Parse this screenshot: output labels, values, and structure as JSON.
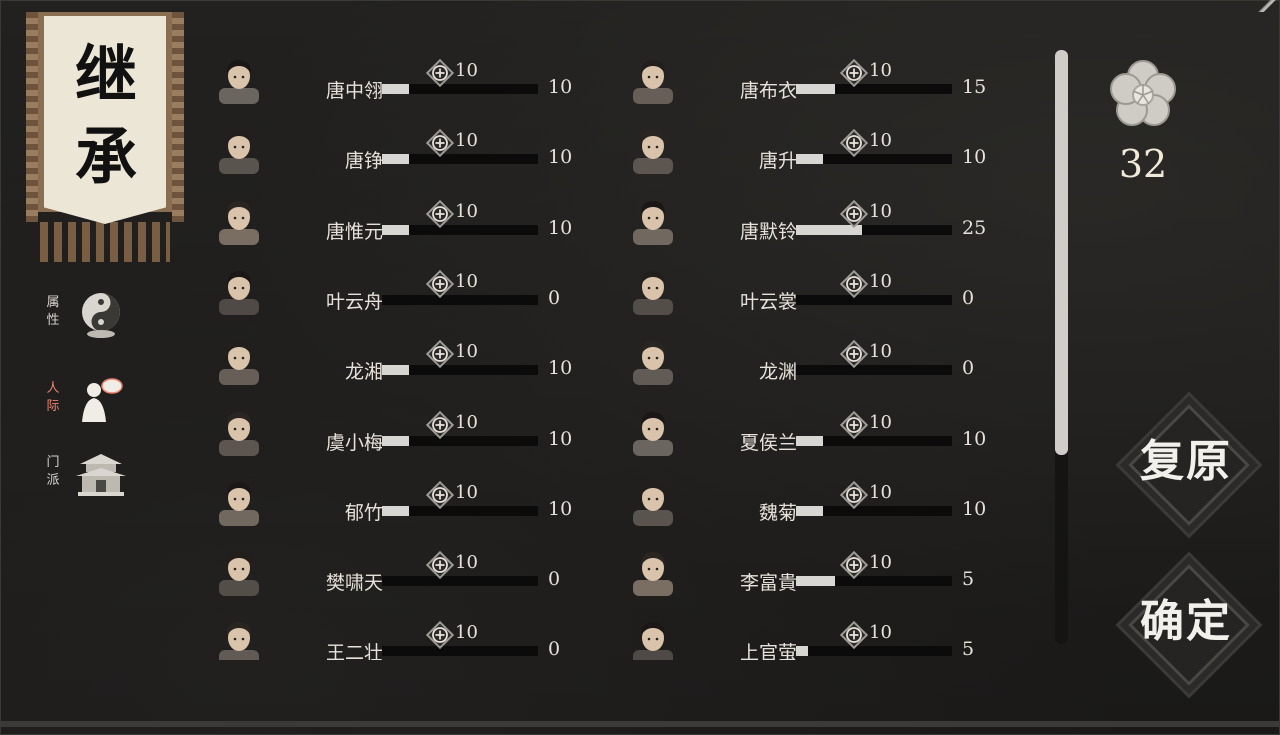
{
  "banner": {
    "title_line1": "继",
    "title_line2": "承"
  },
  "nav": [
    {
      "label": "属性",
      "icon": "yin-yang-meditation-icon",
      "active": false
    },
    {
      "label": "人际",
      "icon": "person-speech-icon",
      "active": true
    },
    {
      "label": "门派",
      "icon": "temple-icon",
      "active": false
    }
  ],
  "plus_label": "10",
  "left_column": [
    {
      "name": "唐中翎",
      "value": "10",
      "fill": 0.17
    },
    {
      "name": "唐铮",
      "value": "10",
      "fill": 0.17
    },
    {
      "name": "唐惟元",
      "value": "10",
      "fill": 0.17
    },
    {
      "name": "叶云舟",
      "value": "0",
      "fill": 0.0
    },
    {
      "name": "龙湘",
      "value": "10",
      "fill": 0.17
    },
    {
      "name": "虞小梅",
      "value": "10",
      "fill": 0.17
    },
    {
      "name": "郁竹",
      "value": "10",
      "fill": 0.17
    },
    {
      "name": "樊啸天",
      "value": "0",
      "fill": 0.0
    },
    {
      "name": "王二壮",
      "value": "0",
      "fill": 0.0
    }
  ],
  "right_column": [
    {
      "name": "唐布衣",
      "value": "15",
      "fill": 0.25
    },
    {
      "name": "唐升",
      "value": "10",
      "fill": 0.17
    },
    {
      "name": "唐默铃",
      "value": "25",
      "fill": 0.42
    },
    {
      "name": "叶云裳",
      "value": "0",
      "fill": 0.0
    },
    {
      "name": "龙渊",
      "value": "0",
      "fill": 0.0
    },
    {
      "name": "夏侯兰",
      "value": "10",
      "fill": 0.17
    },
    {
      "name": "魏菊",
      "value": "10",
      "fill": 0.17
    },
    {
      "name": "李富貴",
      "value": "5",
      "fill": 0.25
    },
    {
      "name": "上官萤",
      "value": "5",
      "fill": 0.08
    }
  ],
  "points": {
    "value": "32",
    "icon": "plum-blossom-icon"
  },
  "buttons": {
    "reset": "复原",
    "confirm": "确定"
  },
  "colors": {
    "accent": "#e9826f",
    "bar": "#d8d6d2",
    "track": "#0b0b0b",
    "background": "#1c1b1a"
  }
}
